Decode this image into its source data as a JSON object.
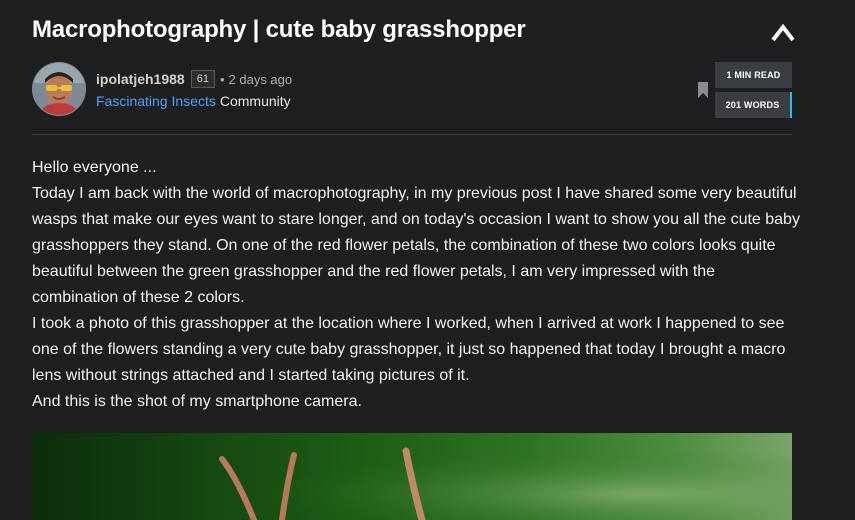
{
  "post": {
    "title": "Macrophotography | cute baby grasshopper",
    "author": {
      "name": "ipolatjeh1988",
      "reputation": "61",
      "separator": "•",
      "time_ago": "2 days ago"
    },
    "community": {
      "name": "Fascinating Insects",
      "suffix": "Community"
    },
    "stats": {
      "read_time": "1 MIN READ",
      "word_count": "201 WORDS"
    },
    "body": [
      "Hello everyone ...",
      "Today I am back with the world of macrophotography, in my previous post I have shared some very beautiful wasps that make our eyes want to stare longer, and on today's occasion I want to show you all the cute baby grasshoppers they stand. On one of the red flower petals, the combination of these two colors looks quite beautiful between the green grasshopper and the red flower petals, I am very impressed with the combination of these 2 colors.",
      "I took a photo of this grasshopper at the location where I worked, when I arrived at work I happened to see one of the flowers standing a very cute baby grasshopper, it just so happened that today I brought a macro lens without strings attached and I started taking pictures of it.",
      "And this is the shot of my smartphone camera."
    ]
  },
  "icons": {
    "collapse": "chevron-up-icon",
    "bookmark": "bookmark-icon"
  },
  "colors": {
    "background": "#1e1f21",
    "link": "#4ba2f2",
    "badge_bg": "#3a3d42",
    "badge_accent": "#23c1e6"
  }
}
